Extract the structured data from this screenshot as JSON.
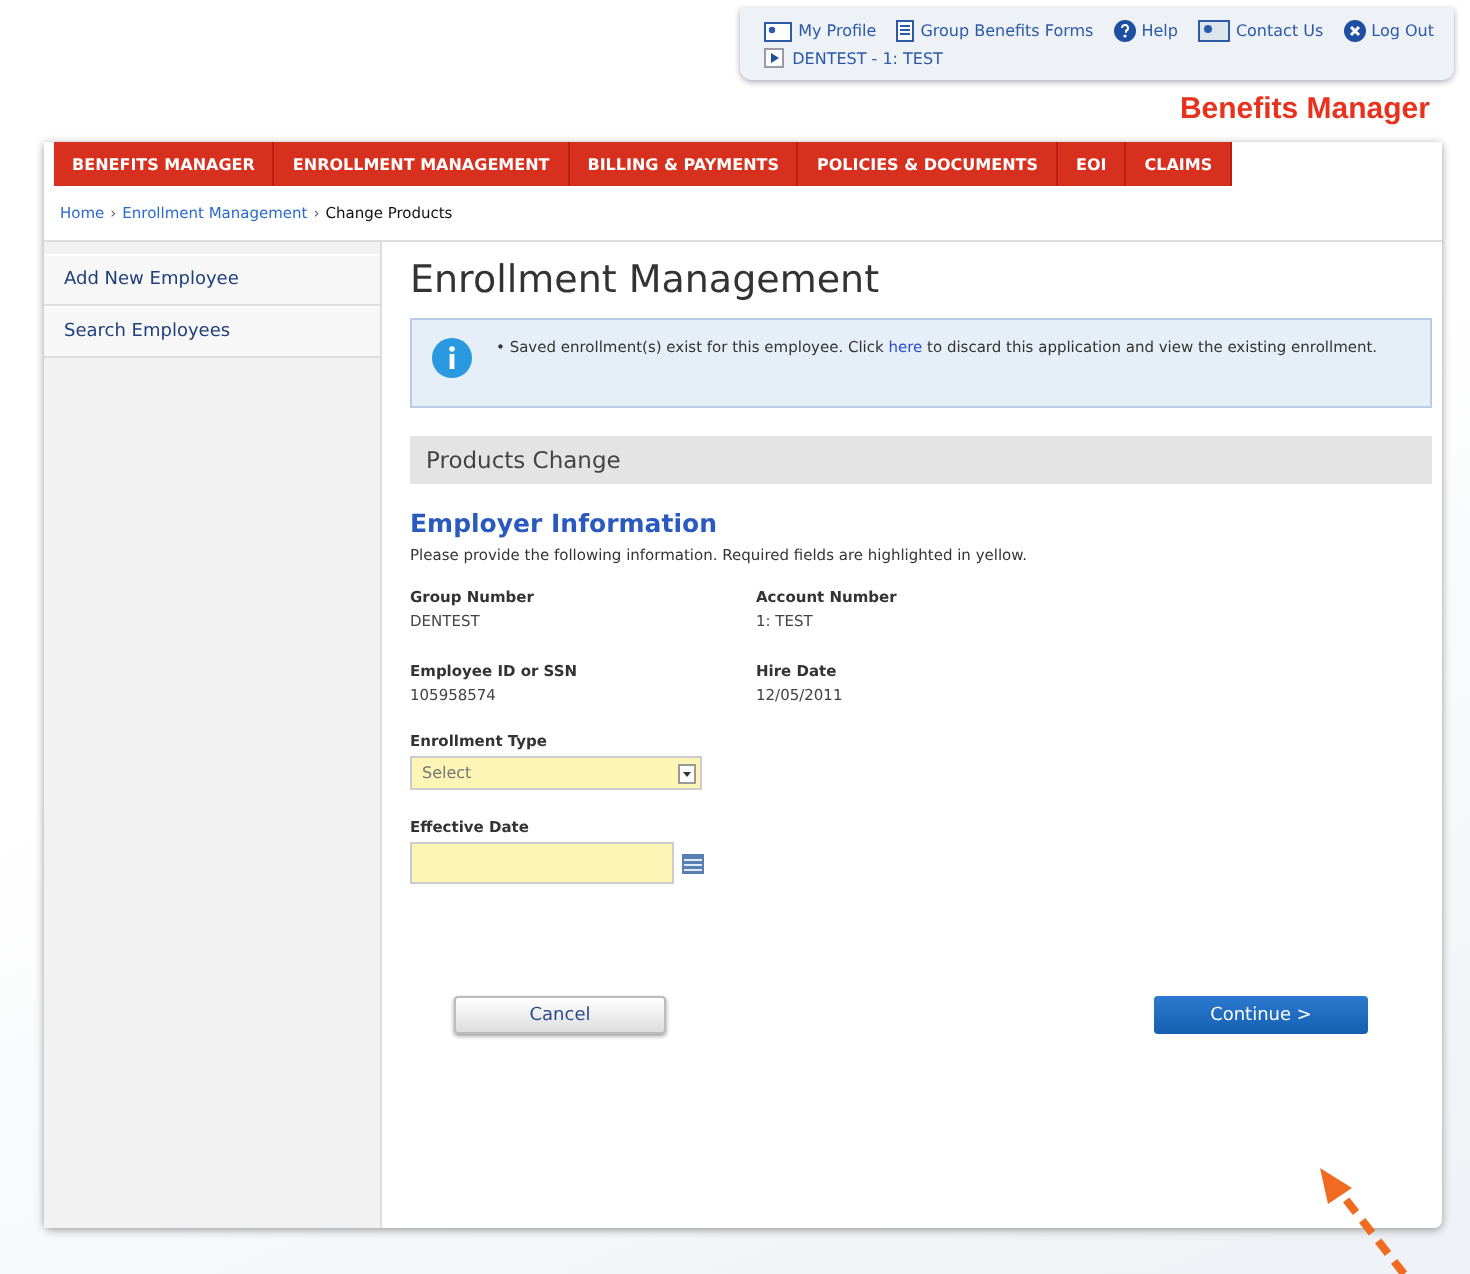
{
  "utility_links": [
    {
      "kind": "profile",
      "label": "My Profile"
    },
    {
      "kind": "forms",
      "label": "Group Benefits Forms"
    },
    {
      "kind": "help",
      "label": "Help"
    },
    {
      "kind": "contact",
      "label": "Contact Us"
    },
    {
      "kind": "logout",
      "label": "Log Out"
    }
  ],
  "account": "DENTEST - 1: TEST",
  "brand": "Benefits Manager",
  "nav": [
    {
      "label": "BENEFITS MANAGER"
    },
    {
      "label": "ENROLLMENT MANAGEMENT"
    },
    {
      "label": "BILLING & PAYMENTS"
    },
    {
      "label": "POLICIES & DOCUMENTS"
    },
    {
      "label": "EOI"
    },
    {
      "label": "CLAIMS"
    }
  ],
  "breadcrumb_separator": "›",
  "breadcrumb": [
    {
      "label": "Home",
      "current": false
    },
    {
      "label": "Enrollment Management",
      "current": false
    },
    {
      "label": "Change Products",
      "current": true
    }
  ],
  "sidebar": [
    {
      "label": "Add New Employee"
    },
    {
      "label": "Search Employees"
    }
  ],
  "title": "Enrollment Management",
  "notice": {
    "bullet": "•",
    "before": "Saved enrollment(s) exist for this employee. Click",
    "link": "here",
    "after": "to discard this application and view the existing enrollment."
  },
  "section": "Products Change",
  "subtitle": "Employer Information",
  "instructions": "Please provide the following information. Required fields are highlighted in yellow.",
  "info_fields": [
    {
      "label": "Group Number",
      "value": "DENTEST"
    },
    {
      "label": "Account Number",
      "value": "1: TEST"
    },
    {
      "label": "Employee ID or SSN",
      "value": "105958574"
    },
    {
      "label": "Hire Date",
      "value": "12/05/2011"
    }
  ],
  "enrollment_type": {
    "label": "Enrollment Type",
    "value": "Select"
  },
  "effective_date": {
    "label": "Effective Date"
  },
  "buttons": {
    "cancel": "Cancel",
    "continue": "Continue >"
  }
}
